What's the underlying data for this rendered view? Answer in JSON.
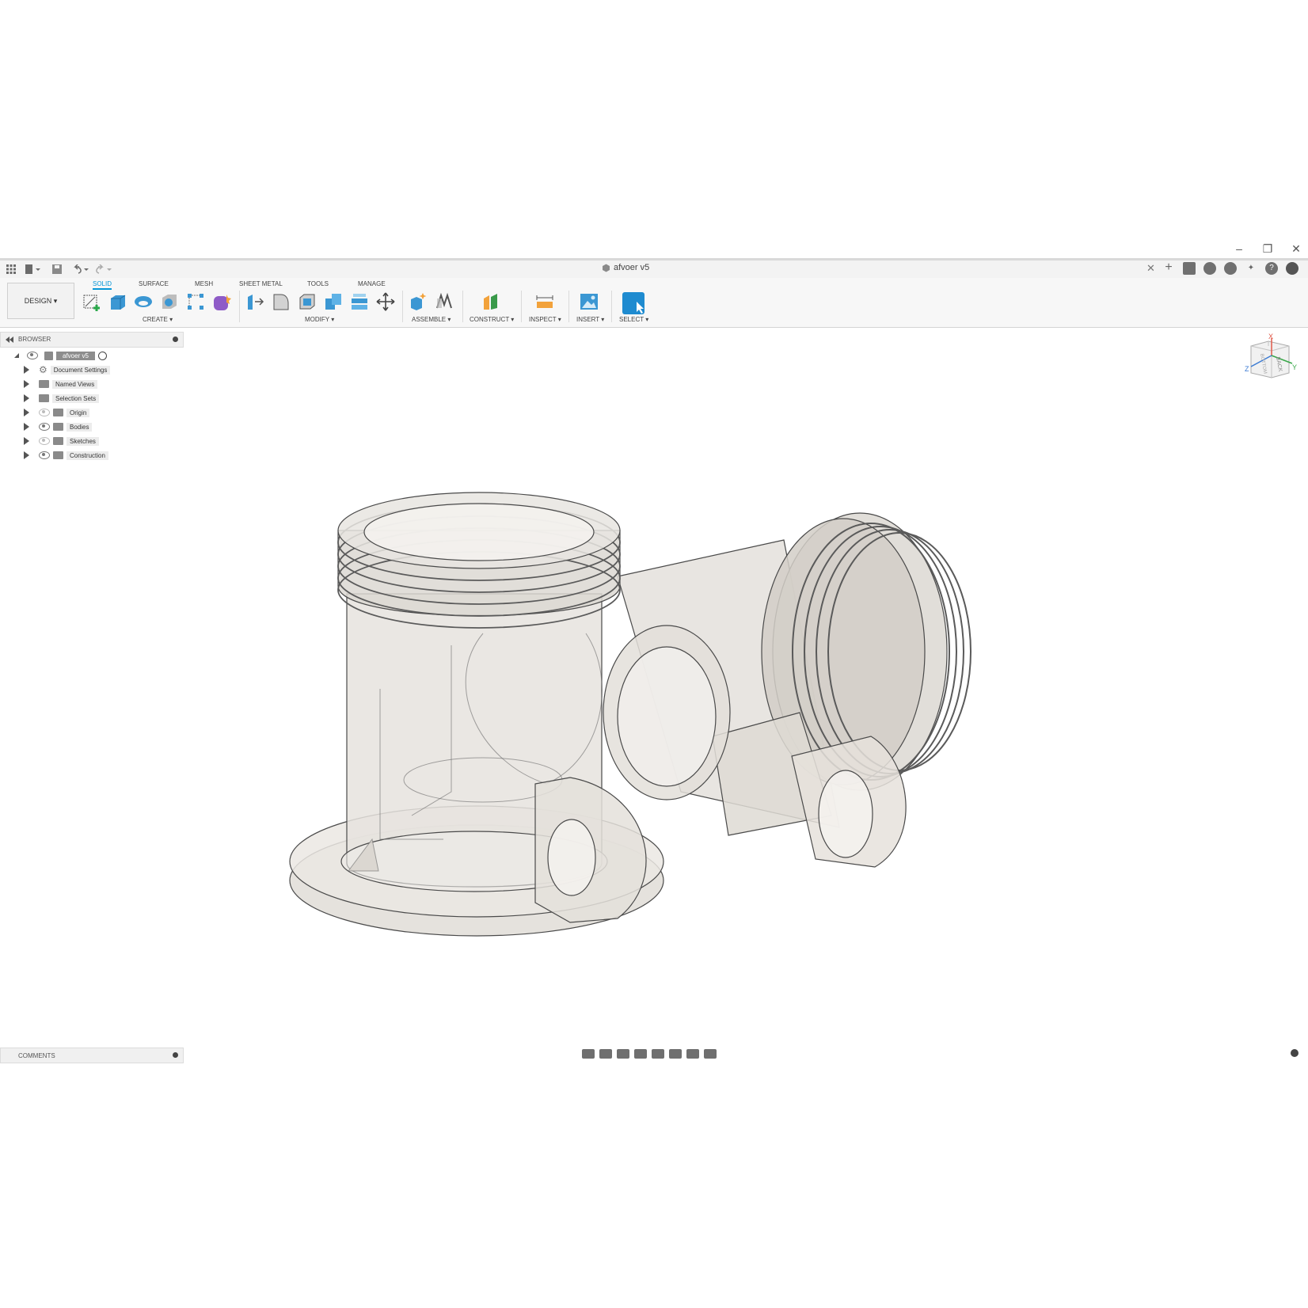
{
  "window": {
    "controls": [
      "–",
      "❐",
      "✕"
    ]
  },
  "document": {
    "title": "afvoer v5"
  },
  "ribbon": {
    "workspace": "DESIGN ▾",
    "tabs": [
      "SOLID",
      "SURFACE",
      "MESH",
      "SHEET METAL",
      "TOOLS",
      "MANAGE"
    ],
    "groups": [
      "CREATE ▾",
      "MODIFY ▾",
      "ASSEMBLE ▾",
      "CONSTRUCT ▾",
      "INSPECT ▾",
      "INSERT ▾",
      "SELECT ▾"
    ]
  },
  "browser": {
    "title": "BROWSER",
    "root": "afvoer v5",
    "items": [
      "Document Settings",
      "Named Views",
      "Selection Sets",
      "Origin",
      "Bodies",
      "Sketches",
      "Construction"
    ]
  },
  "comments": {
    "title": "COMMENTS"
  },
  "viewcube": {
    "top": "BACK",
    "face": "BOTTOM",
    "axis_x": "X",
    "axis_y": "Y",
    "axis_z": "Z"
  },
  "colors": {
    "accent": "#0696d7",
    "model_fill": "#e9e6e1",
    "model_line": "#4a4a4a"
  }
}
